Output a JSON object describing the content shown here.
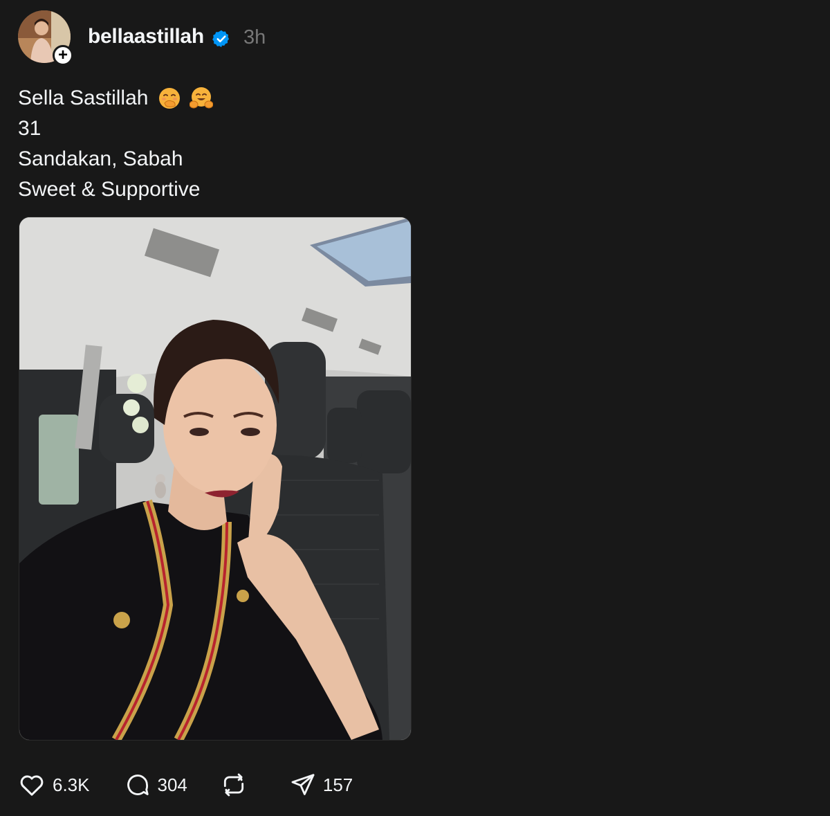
{
  "post": {
    "author": {
      "username": "bellaastillah",
      "verified": true,
      "timestamp": "3h",
      "follow_icon": "plus-icon"
    },
    "caption": {
      "line1": "Sella Sastillah",
      "line1_emojis": [
        "face-with-hand-over-mouth",
        "hugging-face"
      ],
      "line2": "31",
      "line3": "Sandakan, Sabah",
      "line4": "Sweet & Supportive"
    },
    "media": {
      "type": "photo",
      "scene": "selfie of a woman in traditional black attire with gold trim, seated in a vehicle"
    },
    "actions": {
      "like_count": "6.3K",
      "comment_count": "304",
      "repost_count": "",
      "share_count": "157"
    },
    "colors": {
      "background": "#181818",
      "text": "#f3f5f7",
      "muted": "#777777",
      "verified": "#0095f6"
    }
  }
}
